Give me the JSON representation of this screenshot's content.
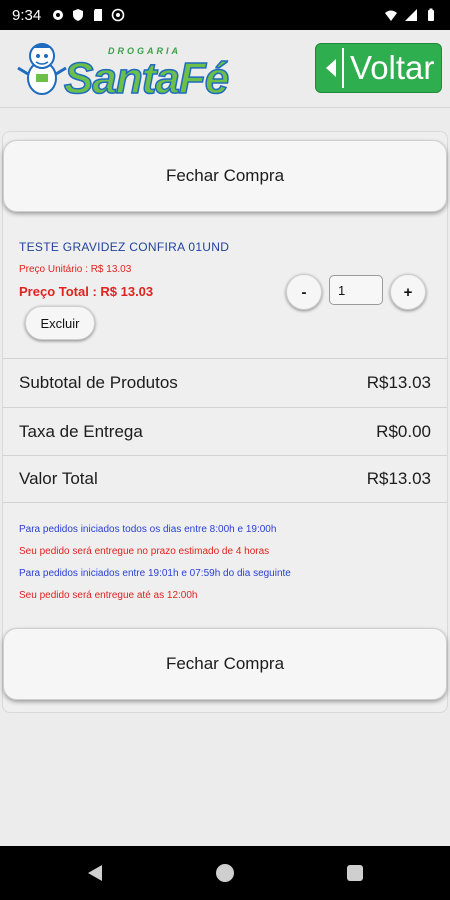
{
  "status_bar": {
    "time": "9:34",
    "left_icons": [
      "gear-icon",
      "shield-icon",
      "sd-card-icon",
      "at-icon"
    ],
    "right_icons": [
      "wifi-icon",
      "signal-icon",
      "battery-icon"
    ]
  },
  "header": {
    "brand_small": "DROGARIA",
    "brand_big": "SantaFé",
    "back_label": "Voltar",
    "colors": {
      "brand_green": "#6cc04a",
      "brand_blue": "#1e6bbf",
      "back_button": "#2fae4f"
    }
  },
  "checkout": {
    "close_label_top": "Fechar Compra",
    "close_label_bottom": "Fechar Compra"
  },
  "item": {
    "name": "TESTE GRAVIDEZ CONFIRA 01UND",
    "unit_price": "Preço Unitário : R$ 13.03",
    "total_price": "Preço Total : R$ 13.03",
    "delete_label": "Excluir",
    "minus_label": "-",
    "plus_label": "+",
    "quantity": "1"
  },
  "summary": {
    "subtotal_label": "Subtotal de Produtos",
    "subtotal_value": "R$13.03",
    "delivery_label": "Taxa de Entrega",
    "delivery_value": "R$0.00",
    "total_label": "Valor Total",
    "total_value": "R$13.03"
  },
  "notes": {
    "line1": "Para pedidos iniciados todos os dias entre 8:00h e 19:00h",
    "line2": "Seu pedido será entregue no prazo estimado de 4 horas",
    "line3": "Para pedidos iniciados entre 19:01h e 07:59h do dia seguinte",
    "line4": "Seu pedido será entregue até as 12:00h",
    "colors": {
      "info": "#2a3fd6",
      "warning": "#e0231e"
    }
  },
  "nav_bar": {
    "icons": [
      "nav-back-icon",
      "nav-home-icon",
      "nav-recents-icon"
    ]
  }
}
